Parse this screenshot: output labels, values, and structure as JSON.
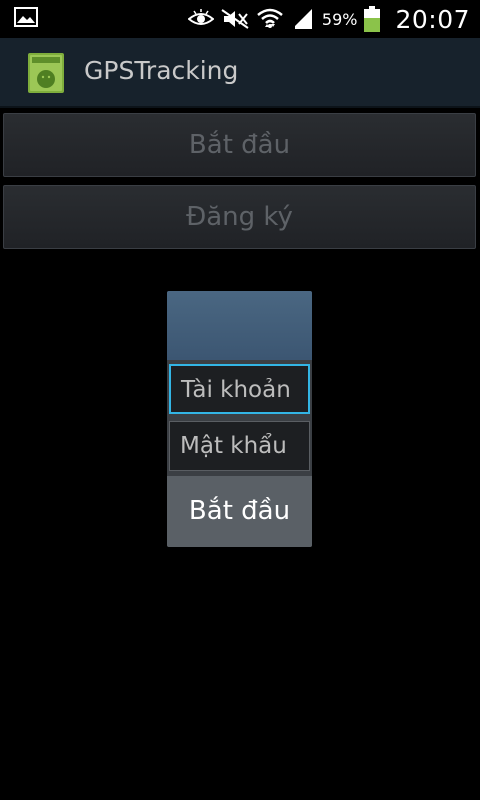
{
  "status_bar": {
    "left_icon": "picture-notification-icon",
    "icons": [
      "eye-icon",
      "mute-icon",
      "wifi-icon",
      "signal-icon",
      "battery-icon"
    ],
    "battery_percent": "59%",
    "time": "20:07",
    "battery_fill_fraction": 0.59,
    "battery_color": "#8bc34a"
  },
  "action_bar": {
    "app_icon": "android-app-icon",
    "title": "GPSTracking",
    "background": "#17222c"
  },
  "main": {
    "start_label": "Bắt đầu",
    "register_label": "Đăng ký"
  },
  "dialog": {
    "header_color": "#4a6782",
    "account_placeholder": "Tài khoản",
    "password_placeholder": "Mật khẩu",
    "start_label": "Bắt đầu",
    "focus_color": "#33b5e5"
  }
}
